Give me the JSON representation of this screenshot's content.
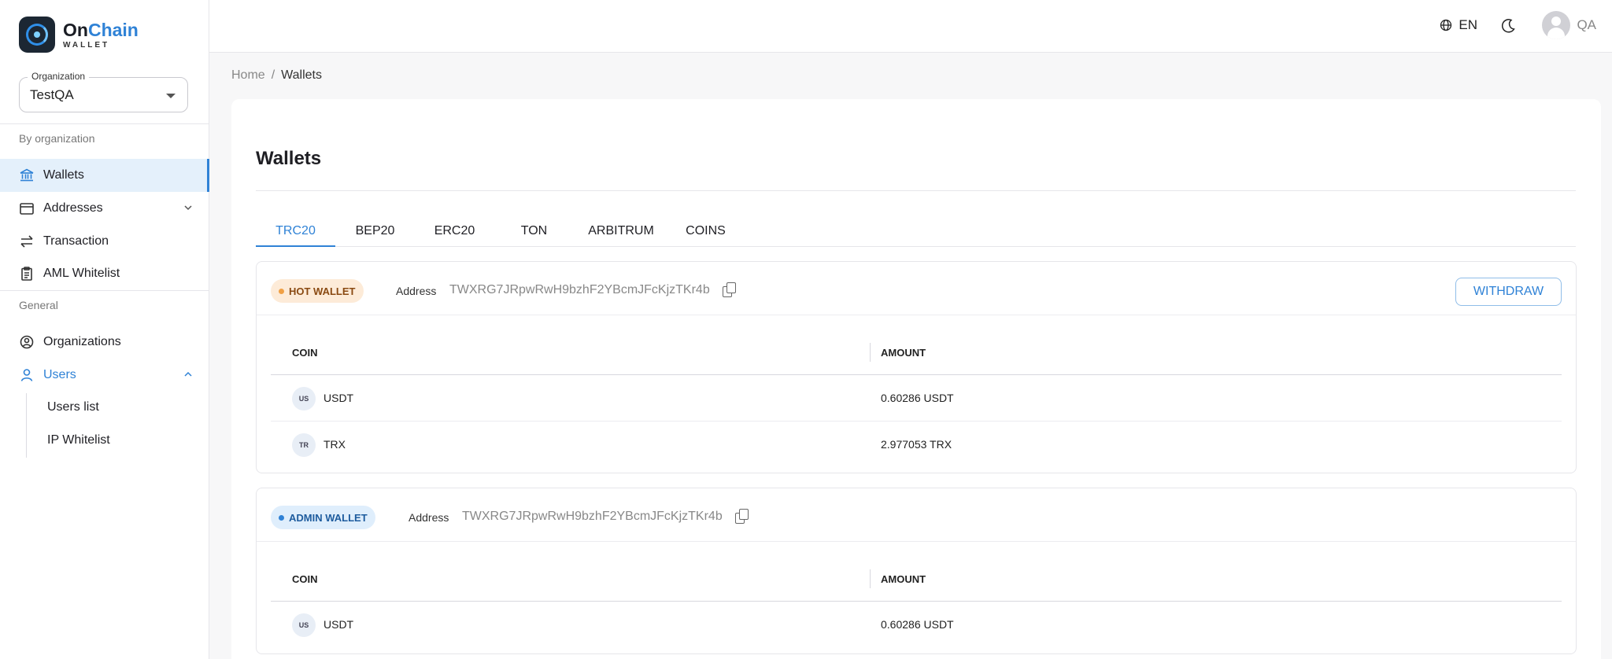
{
  "app": {
    "logo_on": "On",
    "logo_chain": "Chain",
    "logo_sub": "WALLET"
  },
  "sidebar": {
    "org_label": "Organization",
    "org_value": "TestQA",
    "section_by_org": "By organization",
    "section_general": "General",
    "items": [
      {
        "label": "Wallets",
        "icon": "bank-icon",
        "active": true
      },
      {
        "label": "Addresses",
        "icon": "wallet-icon",
        "expandable": true
      },
      {
        "label": "Transaction",
        "icon": "swap-icon"
      },
      {
        "label": "AML Whitelist",
        "icon": "clipboard-icon"
      },
      {
        "label": "Organizations",
        "icon": "organizations-icon"
      },
      {
        "label": "Users",
        "icon": "user-icon",
        "expanded": true
      }
    ],
    "users_sub": [
      "Users list",
      "IP Whitelist"
    ]
  },
  "topbar": {
    "language": "EN",
    "user_initials": "QA"
  },
  "breadcrumb": {
    "home": "Home",
    "separator": "/",
    "current": "Wallets"
  },
  "main": {
    "title": "Wallets",
    "tabs": [
      "TRC20",
      "BEP20",
      "ERC20",
      "TON",
      "ARBITRUM",
      "COINS"
    ],
    "active_tab": "TRC20",
    "address_label": "Address",
    "withdraw_label": "WITHDRAW",
    "col_coin": "COIN",
    "col_amount": "AMOUNT",
    "wallets": [
      {
        "type": "HOT WALLET",
        "address": "TWXRG7JRpwRwH9bzhF2YBcmJFcKjzTKr4b",
        "rows": [
          {
            "icon": "US",
            "coin": "USDT",
            "amount": "0.60286 USDT"
          },
          {
            "icon": "TR",
            "coin": "TRX",
            "amount": "2.977053 TRX"
          }
        ]
      },
      {
        "type": "ADMIN WALLET",
        "address": "TWXRG7JRpwRwH9bzhF2YBcmJFcKjzTKr4b",
        "rows": [
          {
            "icon": "US",
            "coin": "USDT",
            "amount": "0.60286 USDT"
          }
        ]
      }
    ]
  },
  "colors": {
    "accent": "#2f82d6",
    "hot_badge_bg": "#fdebd8",
    "admin_badge_bg": "#dfeefc",
    "active_nav_bg": "#e4f0fb"
  }
}
